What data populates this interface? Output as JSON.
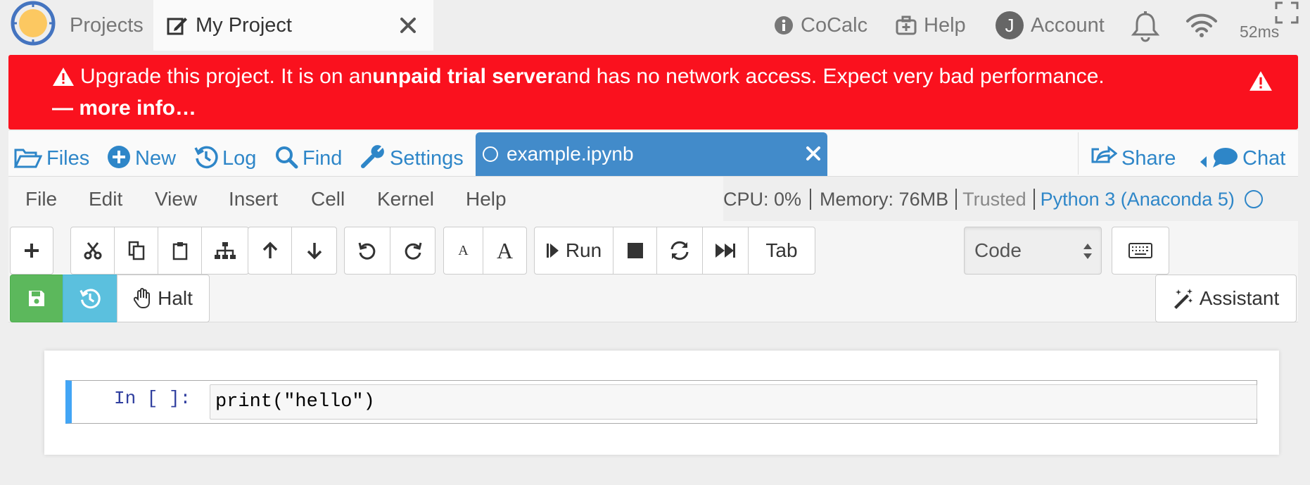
{
  "topbar": {
    "projects_label": "Projects",
    "current_project": "My Project",
    "cocalc_label": "CoCalc",
    "help_label": "Help",
    "account_label": "Account",
    "account_initial": "J",
    "ping": "52ms"
  },
  "banner": {
    "text_part1": "Upgrade this project. It is on an ",
    "text_bold": "unpaid trial server",
    "text_part2": " and has no network access. Expect very bad performance.",
    "more_info": "— more info…",
    "color": "#fa111e"
  },
  "project_nav": {
    "files": "Files",
    "new": "New",
    "log": "Log",
    "find": "Find",
    "settings": "Settings",
    "open_file": "example.ipynb",
    "share": "Share",
    "chat": "Chat"
  },
  "menu": {
    "file": "File",
    "edit": "Edit",
    "view": "View",
    "insert": "Insert",
    "cell": "Cell",
    "kernel": "Kernel",
    "help": "Help"
  },
  "status": {
    "cpu": "CPU: 0%",
    "memory": "Memory: 76MB",
    "trusted": "Trusted",
    "kernel_name": "Python 3 (Anaconda 5)"
  },
  "toolbar": {
    "font_small": "A",
    "font_large": "A",
    "run": "Run",
    "tab": "Tab",
    "cell_type": "Code",
    "halt": "Halt",
    "assistant": "Assistant"
  },
  "notebook": {
    "cells": [
      {
        "prompt": "In [ ]:",
        "source": "print(\"hello\")"
      }
    ]
  },
  "colors": {
    "accent": "#2e86c8",
    "file_tab": "#428bca",
    "save_button": "#5cb85c",
    "timetravel_button": "#5bc0de",
    "cell_selected_bar": "#42a5f5"
  }
}
